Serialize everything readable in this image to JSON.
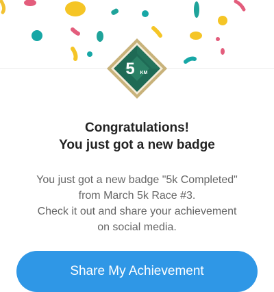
{
  "badge": {
    "number": "5",
    "unit": "KM"
  },
  "heading": {
    "line1": "Congratulations!",
    "line2": "You just got a new badge"
  },
  "message": {
    "line1": "You just got a new badge \"5k Completed\"",
    "line2": "from March 5k Race #3.",
    "line3": "Check it out and share your achievement",
    "line4": "on social media."
  },
  "share_button": {
    "label": "Share My Achievement"
  },
  "colors": {
    "accent": "#2f97e6",
    "badge_green": "#1e6a55",
    "badge_gold": "#c8b27a"
  }
}
